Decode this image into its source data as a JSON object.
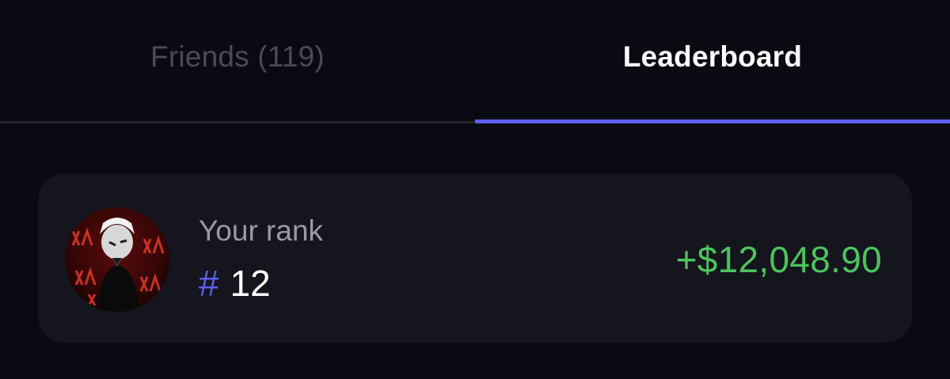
{
  "tabs": [
    {
      "label": "Friends (119)",
      "active": false
    },
    {
      "label": "Leaderboard",
      "active": true
    }
  ],
  "rank_card": {
    "label": "Your rank",
    "hash": "#",
    "rank": "12",
    "earnings": "+$12,048.90",
    "avatar_icon": "user-avatar-image"
  },
  "colors": {
    "background": "#0a0a12",
    "card": "#15151d",
    "accent": "#5b5ef0",
    "positive": "#4cc45e",
    "inactive_text": "#4a4b55"
  }
}
